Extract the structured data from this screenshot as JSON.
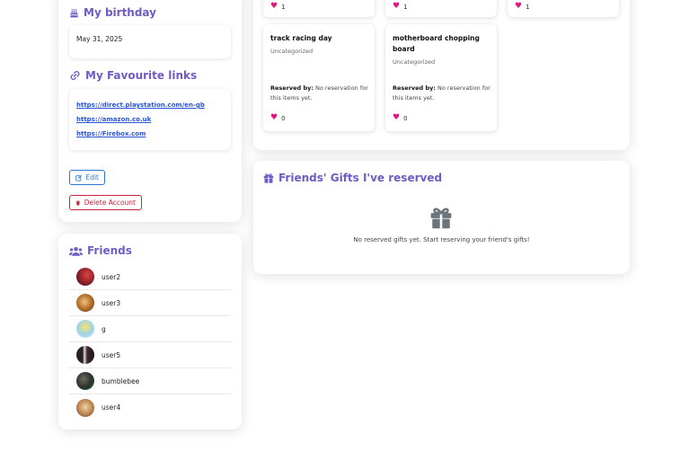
{
  "birthday": {
    "heading": "My birthday",
    "date": "May 31, 2025"
  },
  "links": {
    "heading": "My Favourite links",
    "items": [
      "https://direct.playstation.com/en-gb",
      "https://amazon.co.uk",
      "https://Firebox.com"
    ]
  },
  "actions": {
    "edit_label": "Edit",
    "delete_label": "Delete Account"
  },
  "friends": {
    "heading": "Friends",
    "items": [
      {
        "name": "user2"
      },
      {
        "name": "user3"
      },
      {
        "name": "g"
      },
      {
        "name": "user5"
      },
      {
        "name": "bumblebee"
      },
      {
        "name": "user4"
      }
    ]
  },
  "wishlist": {
    "top_row_likes": [
      "1",
      "1",
      "1"
    ],
    "cards": [
      {
        "title": "track racing day",
        "category": "Uncategorized",
        "reserved_label": "Reserved by:",
        "reserved_text": "No reservation for this items yet.",
        "likes": "0"
      },
      {
        "title": "motherboard chopping board",
        "category": "Uncategorized",
        "reserved_label": "Reserved by:",
        "reserved_text": "No reservation for this items yet.",
        "likes": "0"
      }
    ]
  },
  "reserved": {
    "heading": "Friends' Gifts I've reserved",
    "empty_text": "No reserved gifts yet. Start reserving your friend's gifts!"
  },
  "colors": {
    "accent": "#6f5cc4",
    "edit": "#2e79d0",
    "delete": "#c8233f",
    "heart": "#e0157c",
    "link": "#2b55d9"
  }
}
